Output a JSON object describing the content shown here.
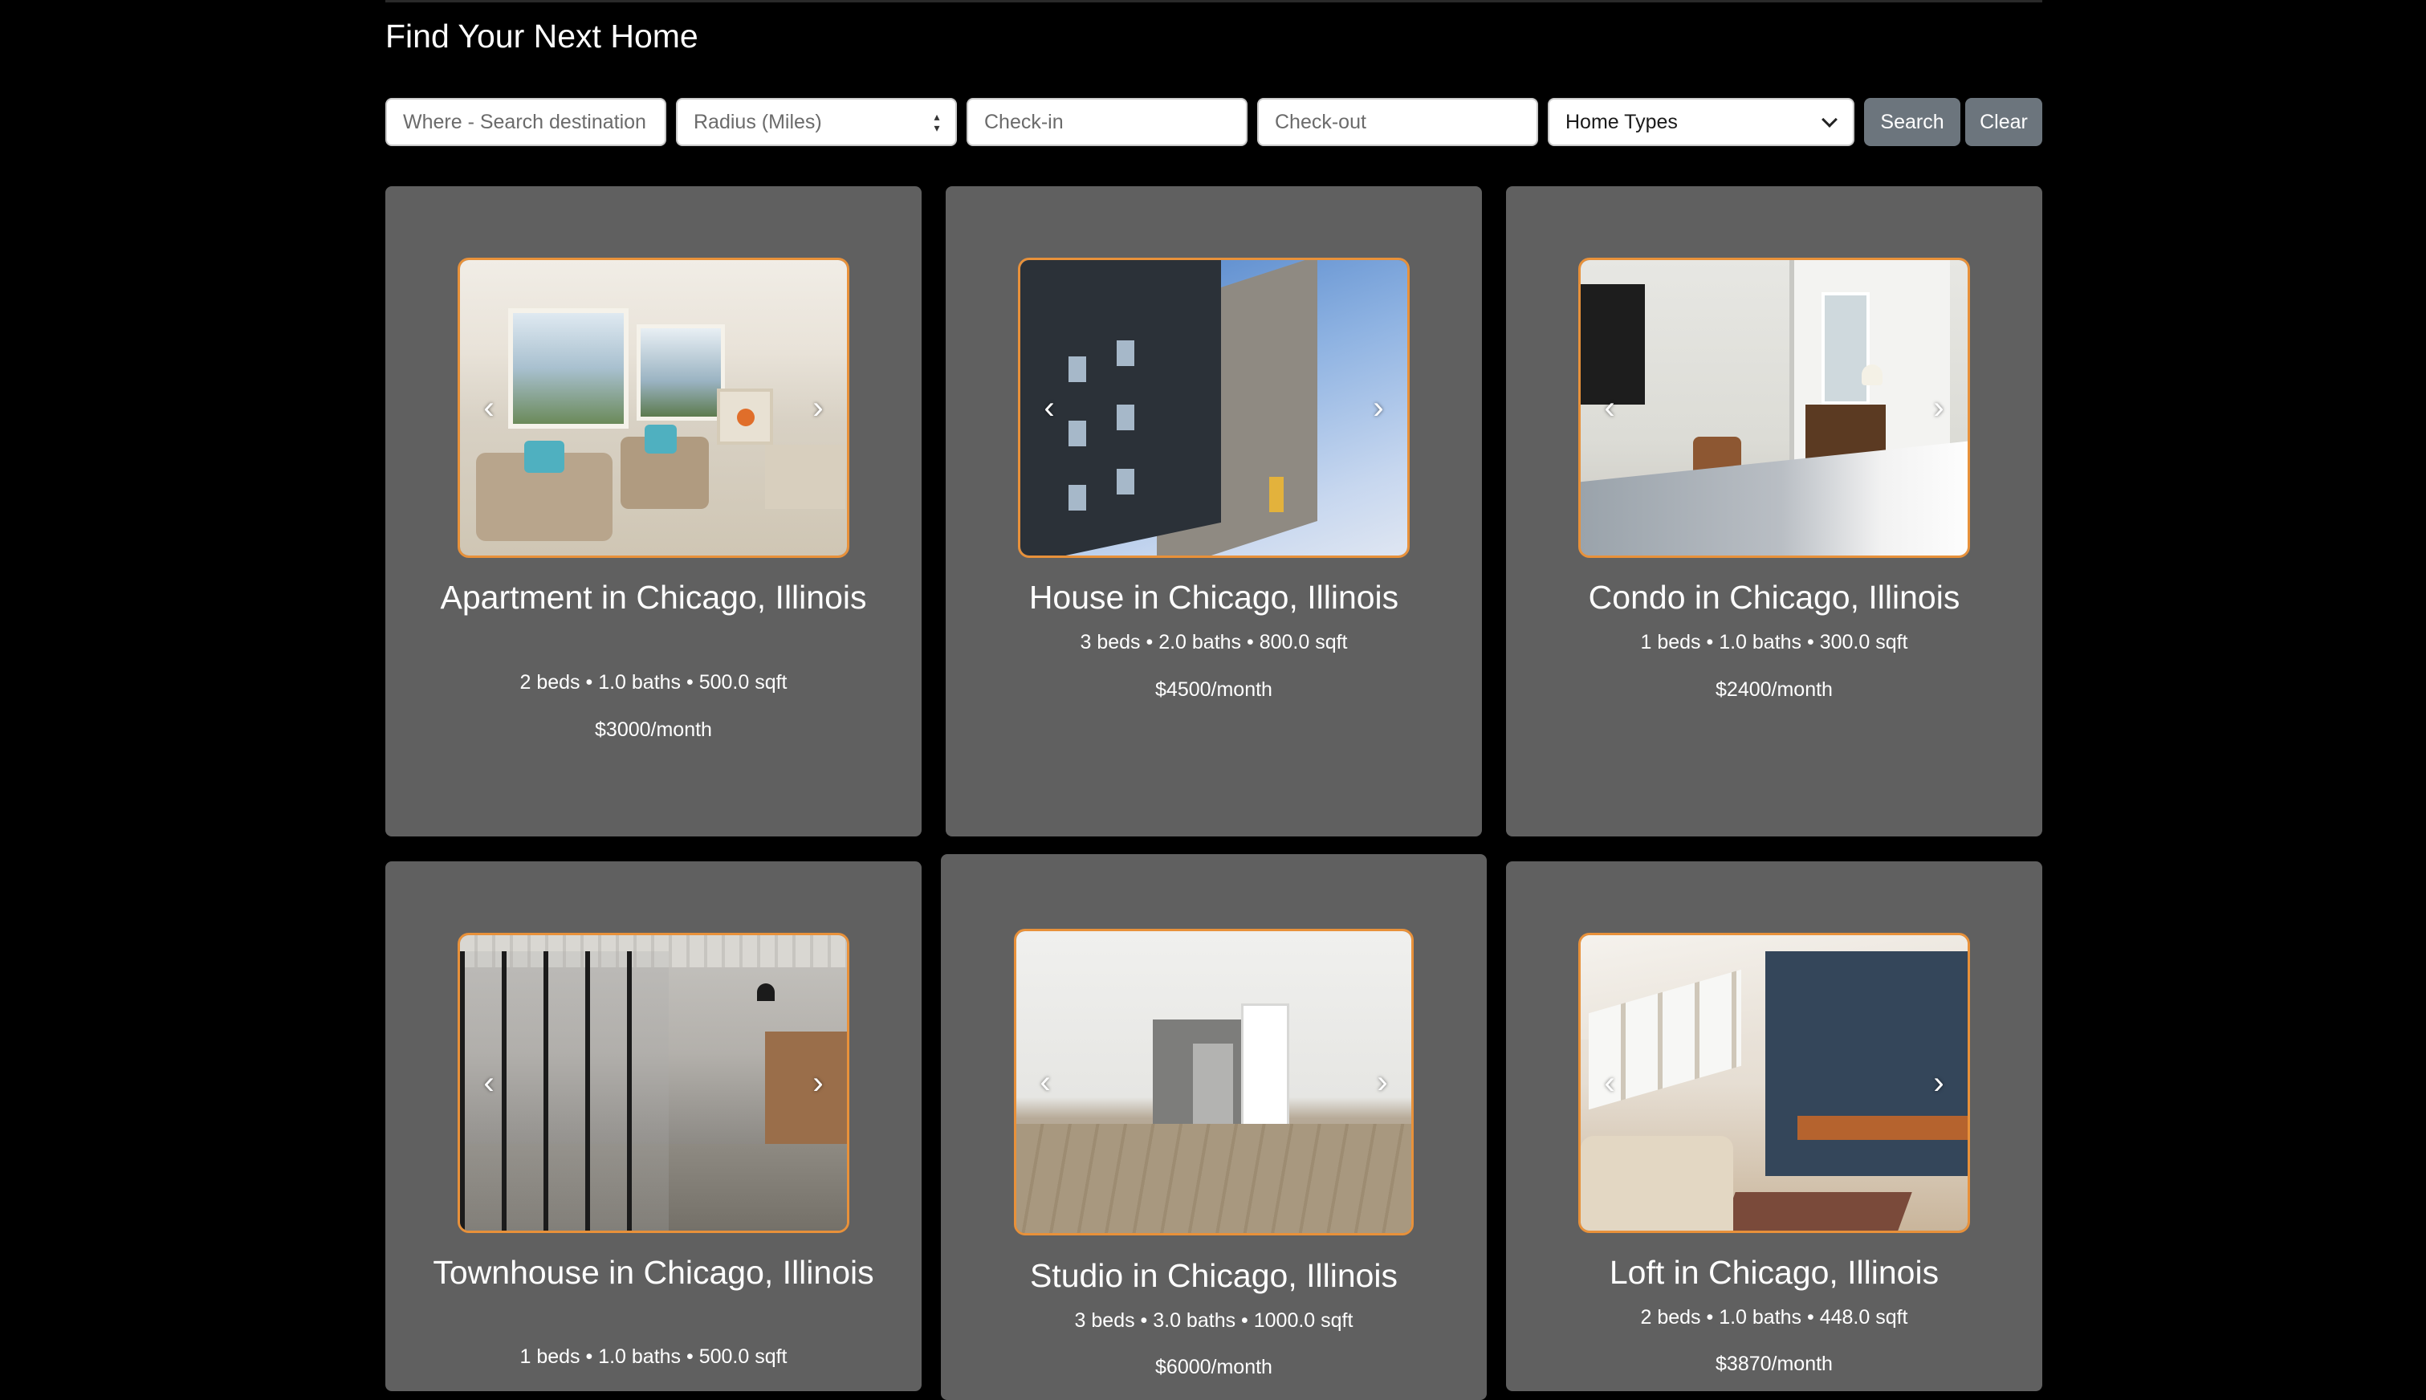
{
  "page": {
    "title": "Find Your Next Home"
  },
  "search": {
    "where_placeholder": "Where - Search destination",
    "radius_placeholder": "Radius (Miles)",
    "checkin_placeholder": "Check-in",
    "checkout_placeholder": "Check-out",
    "home_types_selected": "Home Types",
    "search_label": "Search",
    "clear_label": "Clear"
  },
  "carousel": {
    "prev_glyph": "‹",
    "next_glyph": "›"
  },
  "colors": {
    "page_bg": "#000000",
    "card_bg": "#606060",
    "image_border": "#e8913a",
    "button_bg": "#6c757d"
  },
  "listings": [
    {
      "title": "Apartment in Chicago, Illinois",
      "details": "2 beds • 1.0 baths • 500.0 sqft",
      "price": "$3000/month",
      "photo": "living-room-photo"
    },
    {
      "title": "House in Chicago, Illinois",
      "details": "3 beds • 2.0 baths • 800.0 sqft",
      "price": "$4500/month",
      "photo": "building-exterior-photo"
    },
    {
      "title": "Condo in Chicago, Illinois",
      "details": "1 beds • 1.0 baths • 300.0 sqft",
      "price": "$2400/month",
      "photo": "bedroom-photo"
    },
    {
      "title": "Townhouse in Chicago, Illinois",
      "details": "1 beds • 1.0 baths • 500.0 sqft",
      "price": "",
      "photo": "glass-office-photo"
    },
    {
      "title": "Studio in Chicago, Illinois",
      "details": "3 beds • 3.0 baths • 1000.0 sqft",
      "price": "$6000/month",
      "photo": "studio-kitchen-photo"
    },
    {
      "title": "Loft in Chicago, Illinois",
      "details": "2 beds • 1.0 baths • 448.0 sqft",
      "price": "$3870/month",
      "photo": "loft-living-photo"
    }
  ]
}
